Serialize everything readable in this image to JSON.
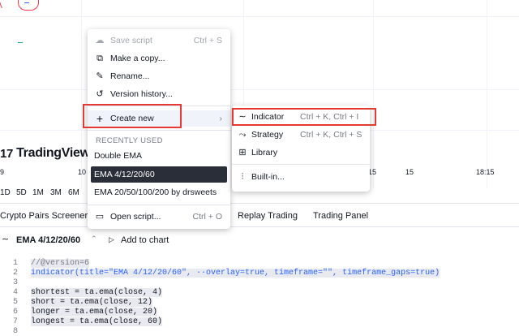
{
  "chart": {
    "x_ticks": [
      "9",
      "10",
      "15",
      "15",
      "18:15"
    ],
    "logo_text": "TradingView",
    "logo_mark": "17"
  },
  "timeframes": [
    "1D",
    "5D",
    "1M",
    "3M",
    "6M"
  ],
  "tabs": {
    "crypto": "Crypto Pairs Screener",
    "replay": "Replay Trading",
    "panel": "Trading Panel"
  },
  "editor": {
    "script_name": "EMA 4/12/20/60",
    "add_to_chart": "Add to chart"
  },
  "code": {
    "line_numbers": [
      "1",
      "2",
      "3",
      "4",
      "5",
      "6",
      "7",
      "8"
    ],
    "lines": [
      "//@version=6",
      "indicator(title=\"EMA 4/12/20/60\", ··overlay=true, timeframe=\"\", timeframe_gaps=true)",
      "",
      "shortest = ta.ema(close, 4)",
      "short = ta.ema(close, 12)",
      "longer = ta.ema(close, 20)",
      "longest = ta.ema(close, 60)",
      ""
    ]
  },
  "menu": {
    "save_script": "Save script",
    "save_shortcut": "Ctrl + S",
    "make_copy": "Make a copy...",
    "rename": "Rename...",
    "version_history": "Version history...",
    "create_new": "Create new",
    "recently_used": "RECENTLY USED",
    "recent": [
      "Double EMA",
      "EMA 4/12/20/60",
      "EMA 20/50/100/200 by drsweets"
    ],
    "open_script": "Open script...",
    "open_shortcut": "Ctrl + O"
  },
  "submenu": {
    "indicator": "Indicator",
    "indicator_shortcut": "Ctrl + K, Ctrl + I",
    "strategy": "Strategy",
    "strategy_shortcut": "Ctrl + K, Ctrl + S",
    "library": "Library",
    "builtin": "Built-in..."
  },
  "colors": {
    "highlight_box": "#e53935",
    "selected_bg": "#2a2e39",
    "keyword": "#2962ff"
  }
}
